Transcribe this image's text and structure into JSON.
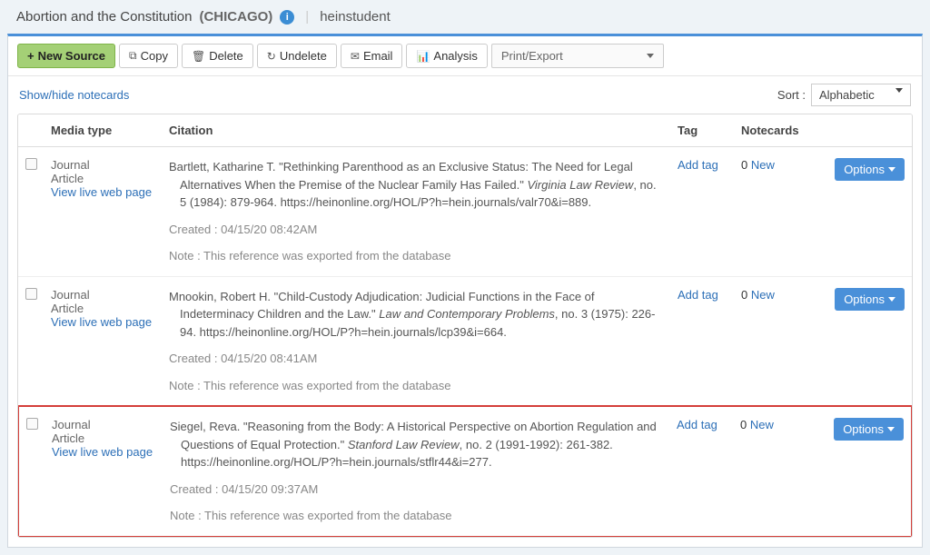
{
  "header": {
    "title": "Abortion and the Constitution",
    "style": "(CHICAGO)",
    "user": "heinstudent"
  },
  "toolbar": {
    "new_source": "New Source",
    "copy": "Copy",
    "delete": "Delete",
    "undelete": "Undelete",
    "email": "Email",
    "analysis": "Analysis",
    "print_export": "Print/Export"
  },
  "subbar": {
    "show_hide": "Show/hide notecards",
    "sort_label": "Sort :",
    "sort_value": "Alphabetic"
  },
  "columns": {
    "media": "Media type",
    "citation": "Citation",
    "tag": "Tag",
    "notecards": "Notecards"
  },
  "rows": [
    {
      "media1": "Journal",
      "media2": "Article",
      "live": "View live web page",
      "c_author": "Bartlett, Katharine T. ",
      "c_title": "\"Rethinking Parenthood as an Exclusive Status: The Need for Legal Alternatives When the Premise of the Nuclear Family Has Failed.\" ",
      "c_pub": "Virginia Law Review",
      "c_rest": ", no. 5 (1984): 879-964. https://heinonline.org/HOL/P?h=hein.journals/valr70&i=889.",
      "created": "Created : 04/15/20 08:42AM",
      "note": "Note : This reference was exported from the database",
      "tag": "Add tag",
      "nc_count": "0",
      "nc_new": " New",
      "opt": "Options",
      "hl": false
    },
    {
      "media1": "Journal",
      "media2": "Article",
      "live": "View live web page",
      "c_author": "Mnookin, Robert H. ",
      "c_title": "\"Child-Custody Adjudication: Judicial Functions in the Face of Indeterminacy Children and the Law.\" ",
      "c_pub": "Law and Contemporary Problems",
      "c_rest": ", no. 3 (1975): 226-94. https://heinonline.org/HOL/P?h=hein.journals/lcp39&i=664.",
      "created": "Created : 04/15/20 08:41AM",
      "note": "Note : This reference was exported from the database",
      "tag": "Add tag",
      "nc_count": "0",
      "nc_new": " New",
      "opt": "Options",
      "hl": false
    },
    {
      "media1": "Journal",
      "media2": "Article",
      "live": "View live web page",
      "c_author": "Siegel, Reva. ",
      "c_title": "\"Reasoning from the Body: A Historical Perspective on Abortion Regulation and Questions of Equal Protection.\" ",
      "c_pub": "Stanford Law Review",
      "c_rest": ", no. 2 (1991-1992): 261-382. https://heinonline.org/HOL/P?h=hein.journals/stflr44&i=277.",
      "created": "Created : 04/15/20 09:37AM",
      "note": "Note : This reference was exported from the database",
      "tag": "Add tag",
      "nc_count": "0",
      "nc_new": " New",
      "opt": "Options",
      "hl": true
    }
  ]
}
